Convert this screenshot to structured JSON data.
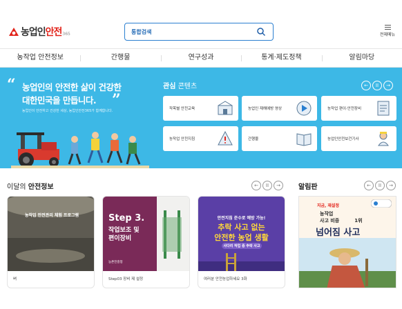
{
  "header": {
    "logo_text_main": "농업인",
    "logo_text_accent": "안전",
    "logo_number": "365",
    "search_label": "통합검색",
    "menu_label": "전체메뉴"
  },
  "nav": {
    "items": [
      "농작업 안전정보",
      "간행물",
      "연구성과",
      "통계·제도정책",
      "알림마당"
    ]
  },
  "hero": {
    "headline_line1": "농업인의 안전한 삶이 건강한",
    "headline_line2": "대한민국을 만듭니다.",
    "subtext": "농업인이 안전하고 건강한 세상, 농업인안전365가 함께합니다."
  },
  "interest": {
    "title_bold": "관심",
    "title_rest": " 콘텐츠",
    "cards": [
      {
        "label": "작목별 안전교육",
        "icon": "farm-building-icon"
      },
      {
        "label": "농업인 재해예방 영상",
        "icon": "video-play-icon"
      },
      {
        "label": "농작업 편이·안전장비",
        "icon": "checklist-icon"
      },
      {
        "label": "농작업 안전지침",
        "icon": "warning-sign-icon"
      },
      {
        "label": "간행물",
        "icon": "book-icon"
      },
      {
        "label": "농업인안전보건기사",
        "icon": "safety-officer-icon"
      }
    ]
  },
  "monthly": {
    "title_prefix": "이달의 ",
    "title_bold": "안전정보",
    "items": [
      {
        "image_title": "농작업 안전관리 체험 프로그램",
        "caption": "벼"
      },
      {
        "image_title_1": "Step 3.",
        "image_title_2": "작업보조 및",
        "image_title_3": "편이장비",
        "image_org": "농촌진흥청",
        "caption": "Step03 장비 제 설정"
      },
      {
        "image_line1": "안전지침 준수로 예방 가능!",
        "image_line2": "추락 사고 없는",
        "image_line3": "안전한 농업 생활",
        "image_line4": "사다리 작업 중 추락 사고",
        "caption": "여러분 안전농업하세요 3화"
      }
    ]
  },
  "notice": {
    "title": "알림판",
    "tag": "지금, 재설정",
    "line1": "농작업",
    "line2_a": "사고 비중",
    "line2_b": "1위",
    "line3": "넘어짐 사고"
  },
  "colors": {
    "hero_bg": "#3db8e6",
    "accent_red": "#e2231a",
    "search_border": "#2a7fd0"
  }
}
